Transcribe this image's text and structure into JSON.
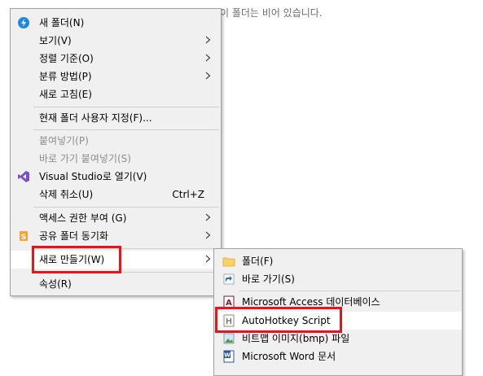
{
  "background_message": "이 폴더는 비어 있습니다.",
  "context_menu": {
    "items": [
      {
        "label": "새 폴더(N)",
        "icon": "new-folder-icon"
      },
      {
        "label": "보기(V)",
        "submenu": true
      },
      {
        "label": "정렬 기준(O)",
        "submenu": true
      },
      {
        "label": "분류 방법(P)",
        "submenu": true
      },
      {
        "label": "새로 고침(E)"
      },
      {
        "label": "현재 폴더 사용자 지정(F)..."
      },
      {
        "label": "붙여넣기(P)",
        "disabled": true
      },
      {
        "label": "바로 가기 붙여넣기(S)",
        "disabled": true
      },
      {
        "label": "Visual Studio로 열기(V)",
        "icon": "visual-studio-icon"
      },
      {
        "label": "삭제 취소(U)",
        "shortcut": "Ctrl+Z"
      },
      {
        "label": "액세스 권한 부여 (G)",
        "submenu": true
      },
      {
        "label": "공유 폴더 동기화",
        "icon": "sync-icon",
        "submenu": true
      },
      {
        "label": "새로 만들기(W)",
        "submenu": true,
        "highlighted": true
      },
      {
        "label": "속성(R)"
      }
    ]
  },
  "new_submenu": {
    "items": [
      {
        "label": "폴더(F)",
        "icon": "folder-icon"
      },
      {
        "label": "바로 가기(S)",
        "icon": "shortcut-icon"
      },
      {
        "label": "Microsoft Access 데이터베이스",
        "icon": "access-icon"
      },
      {
        "label": "AutoHotkey Script",
        "icon": "autohotkey-icon",
        "highlighted": true
      },
      {
        "label": "비트맵 이미지(bmp) 파일",
        "icon": "bitmap-icon"
      },
      {
        "label": "Microsoft Word 문서",
        "icon": "word-icon"
      }
    ]
  },
  "colors": {
    "menu_bg": "#f0f0f0",
    "highlight_border": "#e8141b",
    "disabled_text": "#8d8d8d"
  }
}
